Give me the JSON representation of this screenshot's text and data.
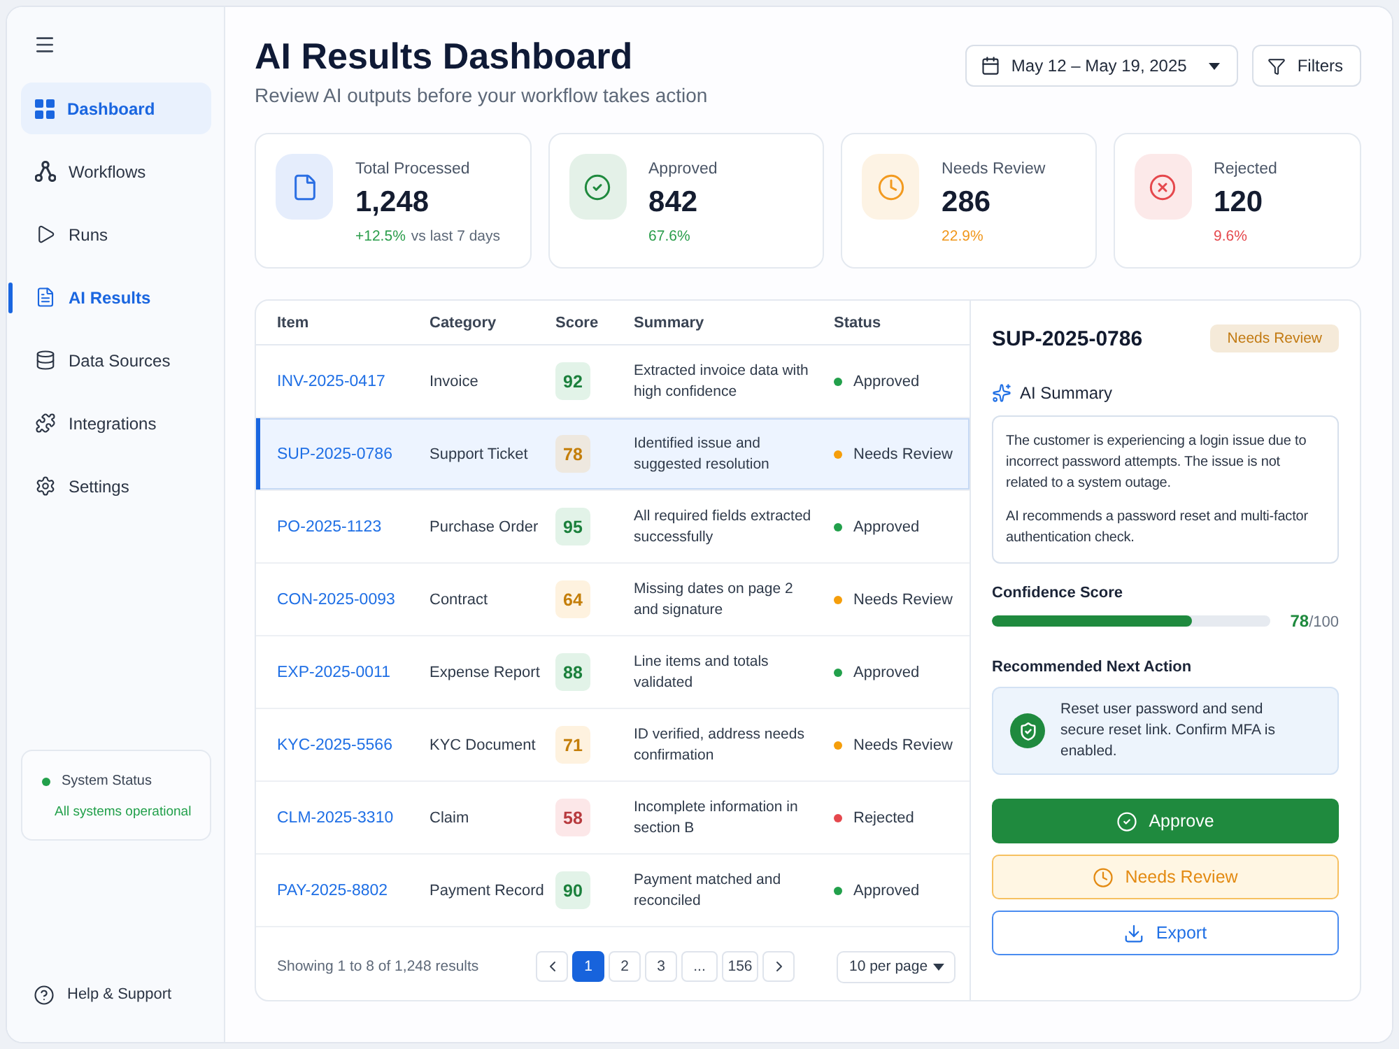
{
  "sidebar": {
    "items": [
      {
        "label": "Dashboard",
        "kind": "grid",
        "highlighted": true,
        "selected": false
      },
      {
        "label": "Workflows",
        "kind": "nodes",
        "highlighted": false,
        "selected": false
      },
      {
        "label": "Runs",
        "kind": "play",
        "highlighted": false,
        "selected": false
      },
      {
        "label": "AI Results",
        "kind": "document",
        "highlighted": false,
        "selected": true
      },
      {
        "label": "Data Sources",
        "kind": "database",
        "highlighted": false,
        "selected": false
      },
      {
        "label": "Integrations",
        "kind": "puzzle",
        "highlighted": false,
        "selected": false
      },
      {
        "label": "Settings",
        "kind": "gear",
        "highlighted": false,
        "selected": false
      }
    ],
    "system_status": {
      "title": "System Status",
      "message": "All systems operational",
      "color": "#22a04b"
    },
    "help": {
      "label": "Help & Support"
    }
  },
  "header": {
    "title": "AI Results Dashboard",
    "subtitle": "Review AI outputs before your workflow takes action",
    "date_range": "May 12 – May 19, 2025",
    "filters": "Filters"
  },
  "stats": [
    {
      "kind": "document",
      "label": "Total Processed",
      "value": "1,248",
      "delta": {
        "text": "+12.5%",
        "color": "#2a9d4b"
      },
      "note": "vs last 7 days",
      "color": "#2b6fe3"
    },
    {
      "kind": "check",
      "label": "Approved",
      "value": "842",
      "delta": {
        "text": "67.6%",
        "color": "#2a9d4b"
      },
      "color": "#1f8a3e"
    },
    {
      "kind": "clock",
      "label": "Needs Review",
      "value": "286",
      "delta": {
        "text": "22.9%",
        "color": "#f0961a"
      },
      "color": "#f29a1f"
    },
    {
      "kind": "x",
      "label": "Rejected",
      "value": "120",
      "delta": {
        "text": "9.6%",
        "color": "#e5484d"
      },
      "color": "#e5484d"
    }
  ],
  "table": {
    "columns": [
      "Item",
      "Category",
      "Score",
      "Summary",
      "Status"
    ],
    "rows": [
      {
        "item": "INV-2025-0417",
        "category": "Invoice",
        "score": "92",
        "summary": "Extracted invoice data with high confidence",
        "status": "Approved",
        "color": "#22a04b",
        "selected": false
      },
      {
        "item": "SUP-2025-0786",
        "category": "Support Ticket",
        "score": "78",
        "summary": "Identified issue and suggested resolution",
        "status": "Needs Review",
        "color": "#f59e0b",
        "selected": true
      },
      {
        "item": "PO-2025-1123",
        "category": "Purchase Order",
        "score": "95",
        "summary": "All required fields extracted successfully",
        "status": "Approved",
        "color": "#22a04b",
        "selected": false
      },
      {
        "item": "CON-2025-0093",
        "category": "Contract",
        "score": "64",
        "summary": "Missing dates on page 2 and signature",
        "status": "Needs Review",
        "color": "#f59e0b",
        "selected": false
      },
      {
        "item": "EXP-2025-0011",
        "category": "Expense Report",
        "score": "88",
        "summary": "Line items and totals validated",
        "status": "Approved",
        "color": "#22a04b",
        "selected": false
      },
      {
        "item": "KYC-2025-5566",
        "category": "KYC Document",
        "score": "71",
        "summary": "ID verified, address needs confirmation",
        "status": "Needs Review",
        "color": "#f59e0b",
        "selected": false
      },
      {
        "item": "CLM-2025-3310",
        "category": "Claim",
        "score": "58",
        "summary": "Incomplete information in section B",
        "status": "Rejected",
        "color": "#e5484d",
        "selected": false
      },
      {
        "item": "PAY-2025-8802",
        "category": "Payment Record",
        "score": "90",
        "summary": "Payment matched and reconciled",
        "status": "Approved",
        "color": "#22a04b",
        "selected": false
      }
    ],
    "footer": {
      "summary": "Showing 1 to 8 of 1,248 results",
      "pages": [
        {
          "label": "1",
          "selected": true
        },
        {
          "label": "2",
          "selected": false
        },
        {
          "label": "3",
          "selected": false
        },
        {
          "label": "...",
          "selected": false
        },
        {
          "label": "156",
          "selected": false
        }
      ],
      "per_page": "10 per page"
    }
  },
  "detail": {
    "title": "SUP-2025-0786",
    "status": {
      "label": "Needs Review",
      "color": "#c27a12"
    },
    "summary_label": "AI Summary",
    "summary": [
      "The customer is experiencing a login issue due to incorrect password attempts. The issue is not related to a system outage.",
      "AI recommends a password reset and multi-factor authentication check."
    ],
    "confidence_label": "Confidence Score",
    "confidence": {
      "level": 0.72,
      "score": "78",
      "max": "/100"
    },
    "next_action_label": "Recommended Next Action",
    "next_action": "Reset user password and send secure reset link. Confirm MFA is enabled.",
    "actions": [
      {
        "kind": "approve",
        "label": "Approve"
      },
      {
        "kind": "review",
        "label": "Needs Review"
      },
      {
        "kind": "export",
        "label": "Export"
      }
    ]
  }
}
